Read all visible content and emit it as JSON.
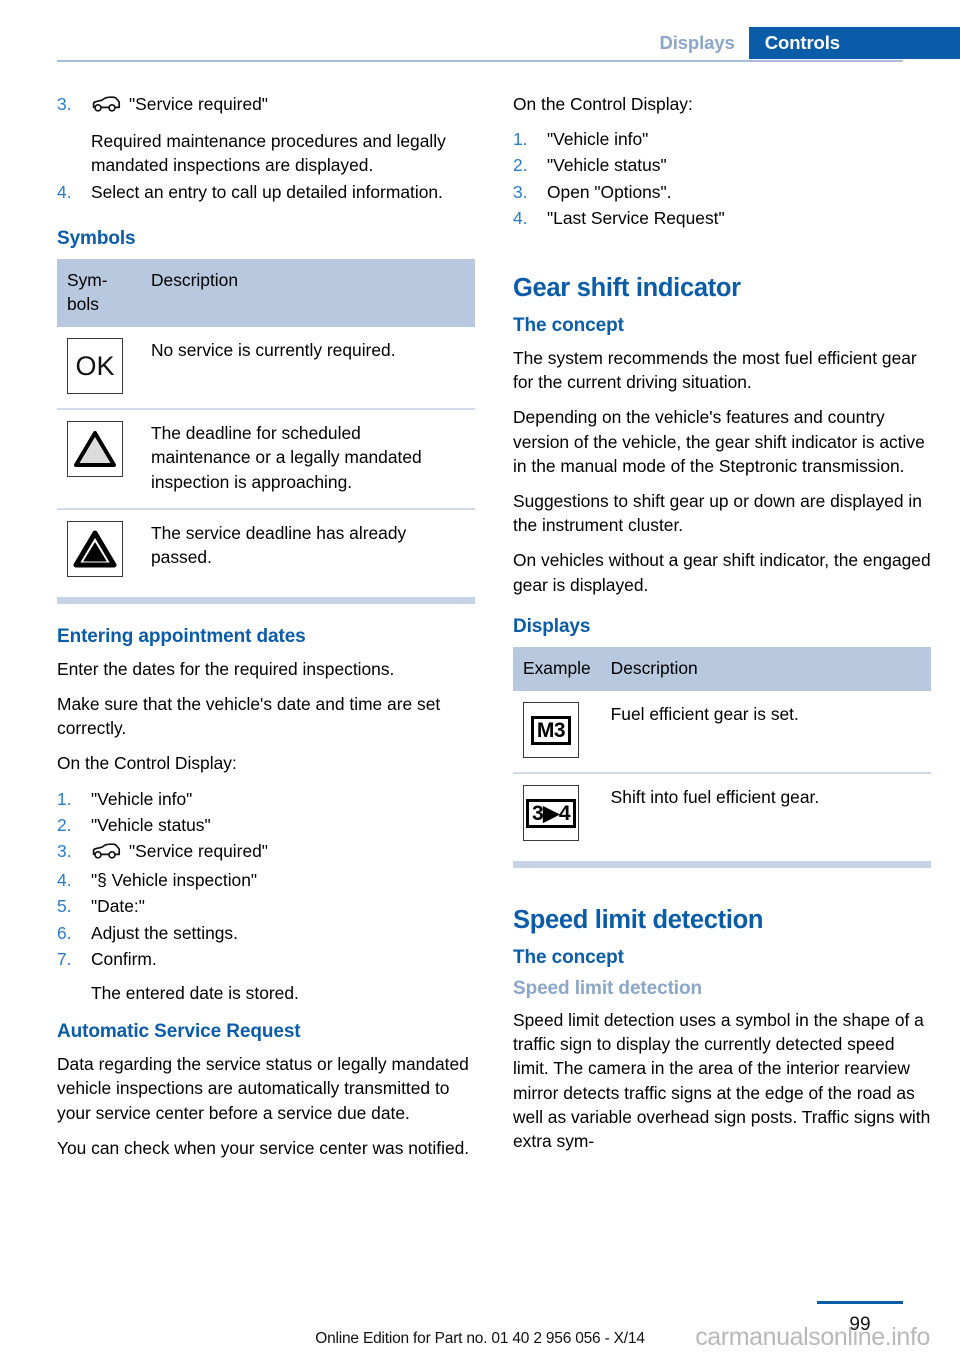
{
  "header": {
    "tab_inactive": "Displays",
    "tab_active": "Controls"
  },
  "colors": {
    "brand_blue": "#0a5ca8",
    "light_blue": "#8ba6c9",
    "table_header_bg": "#b8c8de",
    "table_end_bar": "#c6d3e6",
    "row_divider": "#cfdaeb",
    "step_number": "#2a7cc7"
  },
  "left_column": {
    "steps_top": [
      {
        "num": "3.",
        "icon": "car-icon",
        "text": "\"Service required\""
      },
      {
        "num": "3.sub",
        "text": "Required maintenance procedures and le-gally mandated inspections are displayed."
      },
      {
        "num": "4.",
        "text": "Select an entry to call up detailed informa-tion."
      }
    ],
    "step3_num": "3.",
    "step3_text": "\"Service required\"",
    "step3_detail": "Required maintenance procedures and legally mandated inspections are displayed.",
    "step4_num": "4.",
    "step4_text": "Select an entry to call up detailed information.",
    "symbols_heading": "Symbols",
    "symbols_table": {
      "col_symbols": "Sym-bols",
      "col_description": "Description",
      "rows": [
        {
          "symbol": "OK",
          "symbol_type": "ok-text",
          "description": "No service is currently required."
        },
        {
          "symbol": "warning-triangle-outline",
          "symbol_type": "triangle-outline",
          "description": "The deadline for scheduled maintenance or a legally mandated inspection is approaching."
        },
        {
          "symbol": "warning-triangle-filled",
          "symbol_type": "triangle-filled",
          "description": "The service deadline has already passed."
        }
      ]
    },
    "appointment_heading": "Entering appointment dates",
    "appointment_p1": "Enter the dates for the required inspections.",
    "appointment_p2": "Make sure that the vehicle's date and time are set correctly.",
    "appointment_p3": "On the Control Display:",
    "appointment_steps": [
      {
        "num": "1.",
        "text": "\"Vehicle info\"",
        "icon": ""
      },
      {
        "num": "2.",
        "text": "\"Vehicle status\"",
        "icon": ""
      },
      {
        "num": "3.",
        "text": "\"Service required\"",
        "icon": "car-icon"
      },
      {
        "num": "4.",
        "text": "\"§ Vehicle inspection\"",
        "icon": ""
      },
      {
        "num": "5.",
        "text": "\"Date:\"",
        "icon": ""
      },
      {
        "num": "6.",
        "text": "Adjust the settings.",
        "icon": ""
      },
      {
        "num": "7.",
        "text": "Confirm.",
        "icon": ""
      }
    ],
    "appointment_result": "The entered date is stored.",
    "auto_request_heading": "Automatic Service Request",
    "auto_request_p1": "Data regarding the service status or legally mandated vehicle inspections are automatically transmitted to your service center before a service due date.",
    "auto_request_p2": "You can check when your service center was notified."
  },
  "right_column": {
    "control_display_intro": "On the Control Display:",
    "control_display_steps": [
      {
        "num": "1.",
        "text": "\"Vehicle info\""
      },
      {
        "num": "2.",
        "text": "\"Vehicle status\""
      },
      {
        "num": "3.",
        "text": "Open \"Options\"."
      },
      {
        "num": "4.",
        "text": "\"Last Service Request\""
      }
    ],
    "gear_shift_heading": "Gear shift indicator",
    "gear_concept_heading": "The concept",
    "gear_concept_p1": "The system recommends the most fuel efficient gear for the current driving situation.",
    "gear_concept_p2": "Depending on the vehicle's features and country version of the vehicle, the gear shift indicator is active in the manual mode of the Steptronic transmission.",
    "gear_concept_p3": "Suggestions to shift gear up or down are displayed in the instrument cluster.",
    "gear_concept_p4": "On vehicles without a gear shift indicator, the engaged gear is displayed.",
    "displays_heading": "Displays",
    "displays_table": {
      "col_example": "Example",
      "col_description": "Description",
      "rows": [
        {
          "example": "M3",
          "description": "Fuel efficient gear is set."
        },
        {
          "example": "3▶4",
          "description": "Shift into fuel efficient gear."
        }
      ]
    },
    "speed_limit_heading": "Speed limit detection",
    "speed_concept_heading": "The concept",
    "speed_sub_heading": "Speed limit detection",
    "speed_p1": "Speed limit detection uses a symbol in the shape of a traffic sign to display the currently detected speed limit. The camera in the area of the interior rearview mirror detects traffic signs at the edge of the road as well as variable overhead sign posts. Traffic signs with extra sym-"
  },
  "footer": {
    "edition": "Online Edition for Part no. 01 40 2 956 056 - X/14",
    "page_number": "99",
    "watermark": "carmanualsonline.info"
  }
}
